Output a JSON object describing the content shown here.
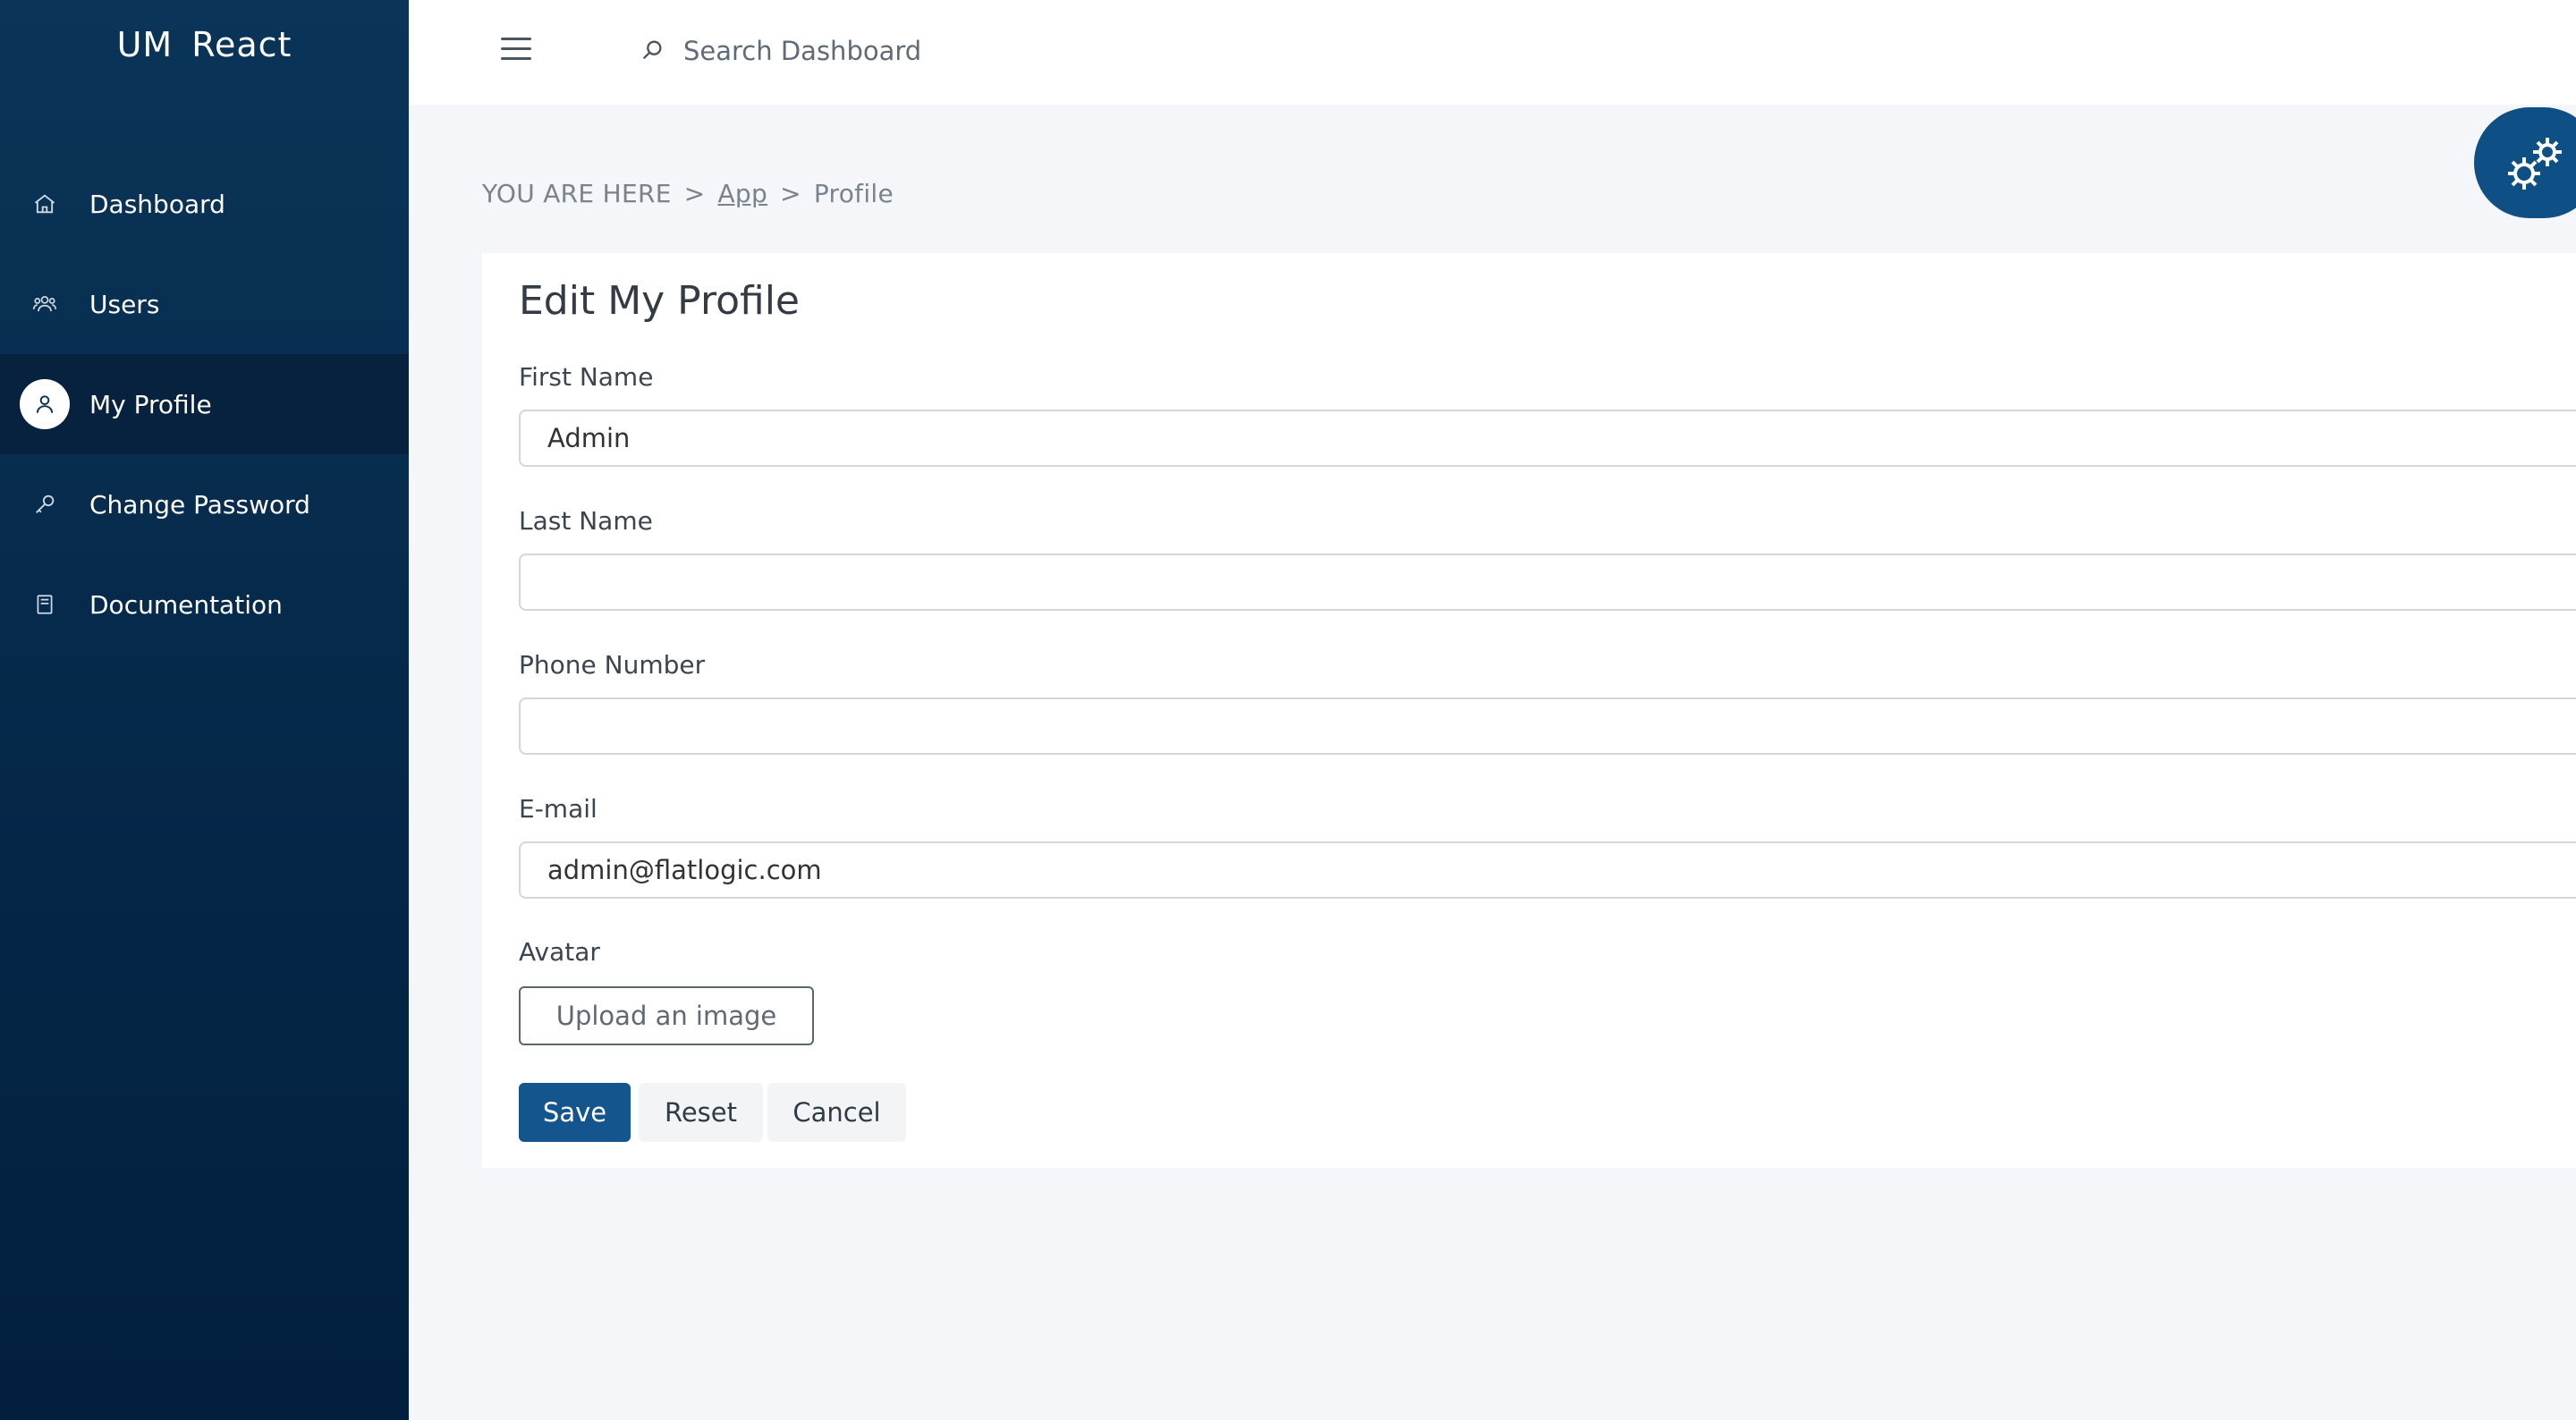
{
  "app": {
    "title": "UM React"
  },
  "sidebar": {
    "items": [
      {
        "label": "Dashboard",
        "icon": "home-icon",
        "active": false
      },
      {
        "label": "Users",
        "icon": "users-icon",
        "active": false
      },
      {
        "label": "My Profile",
        "icon": "user-icon",
        "active": true
      },
      {
        "label": "Change Password",
        "icon": "key-icon",
        "active": false
      },
      {
        "label": "Documentation",
        "icon": "book-icon",
        "active": false
      }
    ]
  },
  "header": {
    "search_placeholder": "Search Dashboard"
  },
  "breadcrumb": {
    "prefix": "YOU ARE HERE",
    "separator": ">",
    "items": [
      "App",
      "Profile"
    ]
  },
  "form": {
    "title": "Edit My Profile",
    "fields": [
      {
        "label": "First Name",
        "value": "Admin"
      },
      {
        "label": "Last Name",
        "value": ""
      },
      {
        "label": "Phone Number",
        "value": ""
      },
      {
        "label": "E-mail",
        "value": "admin@flatlogic.com"
      }
    ],
    "avatar_label": "Avatar",
    "upload_label": "Upload an image",
    "save_label": "Save",
    "reset_label": "Reset",
    "cancel_label": "Cancel"
  },
  "colors": {
    "sidebar_bg": "#052647",
    "primary": "#14558e"
  }
}
